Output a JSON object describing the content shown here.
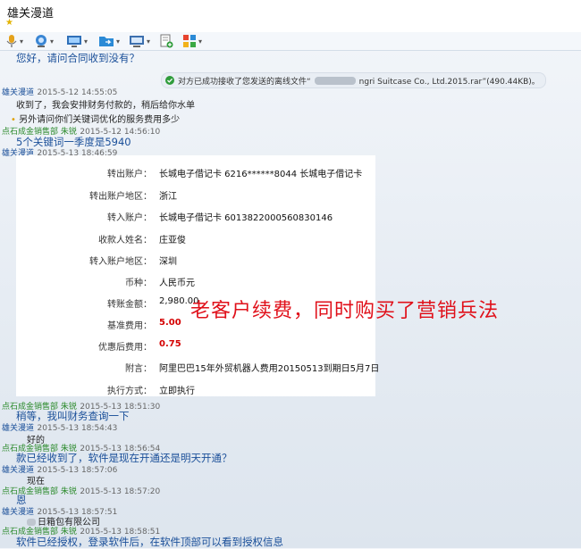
{
  "window": {
    "title": "雄关漫道"
  },
  "toolbar": {
    "icons": [
      "microphone-icon",
      "webcam-icon",
      "screen-share-icon",
      "file-transfer-icon",
      "remote-desktop-icon",
      "add-app-icon",
      "apps-grid-icon"
    ]
  },
  "colors": {
    "sender_self": "#1a4f99",
    "sender_other": "#2b8a2b",
    "highlight_red": "#d40000",
    "overlay_red": "#e0101a"
  },
  "chat": {
    "first_msg": "您好，请问合同收到没有？",
    "file_notice": {
      "prefix": "对方已成功接收了您发送的离线文件“",
      "name_visible": "ngri Suitcase Co., Ltd.2015.rar”(490.44KB)。"
    },
    "entries": [
      {
        "sender": "雄关漫道",
        "time": "2015-5-12 14:55:05",
        "lines": [
          "收到了，我会安排财务付款的，稍后给你水单",
          "另外请问你们关键词优化的服务费用多少"
        ]
      },
      {
        "sender": "点石成金销售部 朱锐",
        "time": "2015-5-12 14:56:10",
        "lines": [
          "5个关键词一季度是5940"
        ]
      },
      {
        "sender": "雄关漫道",
        "time": "2015-5-13 18:46:59"
      },
      {
        "sender": "点石成金销售部 朱锐",
        "time": "2015-5-13 18:51:30",
        "lines": [
          "稍等，我叫财务查询一下"
        ]
      },
      {
        "sender": "雄关漫道",
        "time": "2015-5-13 18:54:43",
        "lines": [
          "好的"
        ]
      },
      {
        "sender": "点石成金销售部 朱锐",
        "time": "2015-5-13 18:56:54",
        "lines": [
          "款已经收到了，软件是现在开通还是明天开通？"
        ]
      },
      {
        "sender": "雄关漫道",
        "time": "2015-5-13 18:57:06",
        "lines": [
          "现在"
        ]
      },
      {
        "sender": "点石成金销售部 朱锐",
        "time": "2015-5-13 18:57:20",
        "lines": [
          "恩"
        ]
      },
      {
        "sender": "雄关漫道",
        "time": "2015-5-13 18:57:51",
        "lines": [
          "日箱包有限公司"
        ]
      },
      {
        "sender": "点石成金销售部 朱锐",
        "time": "2015-5-13 18:58:51",
        "lines": [
          "软件已经授权，登录软件后，在软件顶部可以看到授权信息"
        ]
      }
    ]
  },
  "receipt": {
    "rows": [
      {
        "label": "转出账户：",
        "value": "长城电子借记卡 6216******8044 长城电子借记卡"
      },
      {
        "label": "转出账户地区：",
        "value": "浙江"
      },
      {
        "label": "转入账户：",
        "value": "长城电子借记卡 6013822000560830146"
      },
      {
        "label": "收款人姓名：",
        "value": "庄亚俊"
      },
      {
        "label": "转入账户地区：",
        "value": "深圳"
      },
      {
        "label": "币种：",
        "value": "人民币元"
      },
      {
        "label": "转账金额：",
        "value": "2,980.00"
      },
      {
        "label": "基准费用：",
        "value": "5.00"
      },
      {
        "label": "优惠后费用：",
        "value": "0.75"
      },
      {
        "label": "附言：",
        "value": "阿里巴巴15年外贸机器人费用20150513到期日5月7日"
      },
      {
        "label": "执行方式：",
        "value": "立即执行"
      }
    ]
  },
  "overlay_text": "老客户续费，同时购买了营销兵法"
}
